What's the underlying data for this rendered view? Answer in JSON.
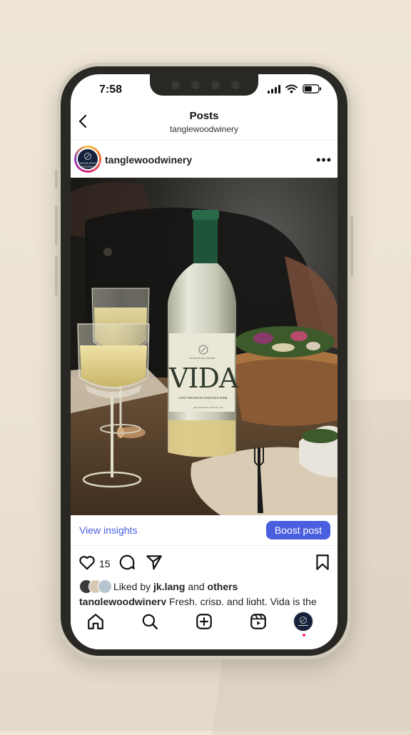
{
  "status_bar": {
    "time": "7:58"
  },
  "header": {
    "title": "Posts",
    "subtitle": "tanglewoodwinery"
  },
  "post": {
    "username": "tanglewoodwinery",
    "avatar_text": "TANGLEWOOD WINERY",
    "bottle": {
      "brand": "TANGLEWOOD WINERY",
      "name": "VIDA",
      "tagline": "A DRY MICHIGAN VIGNOLES WINE",
      "fine_print": "2021 ALCOHOL 11.5% BY VOL"
    },
    "likes_count": "15",
    "liked_by_prefix": "Liked by ",
    "liked_by_user": "jk.lang",
    "liked_by_and": " and ",
    "liked_by_others": "others",
    "caption_user": "tanglewoodwinery",
    "caption_text": " Fresh, crisp, and light. Vida is the"
  },
  "insights": {
    "view_label": "View insights",
    "boost_label": "Boost post"
  },
  "colors": {
    "accent": "#4a5ee0",
    "notification": "#ff2d55",
    "text": "#222222"
  }
}
